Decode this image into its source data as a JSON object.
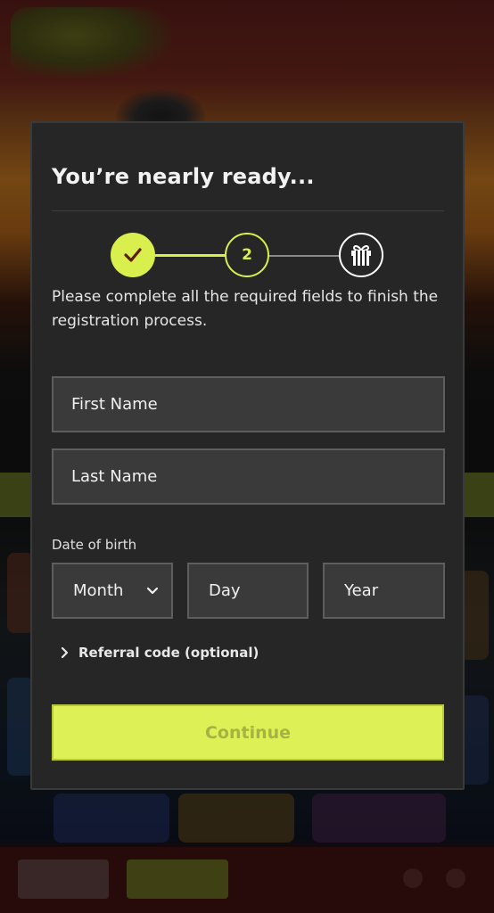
{
  "modal": {
    "title": "You’re nearly ready...",
    "instructions": "Please complete all the required fields to finish the registration process.",
    "stepper": {
      "step1_icon": "checkmark-icon",
      "step2_label": "2",
      "step3_icon": "gift-icon",
      "active_color": "#d9ef4e"
    },
    "fields": {
      "first_name_placeholder": "First Name",
      "last_name_placeholder": "Last Name"
    },
    "dob": {
      "label": "Date of birth",
      "month": "Month",
      "day": "Day",
      "year": "Year"
    },
    "referral_label": "Referral code (optional)",
    "continue_label": "Continue"
  },
  "colors": {
    "accent": "#ddf055",
    "modal_bg": "#262626",
    "field_bg": "#3a3a3a"
  }
}
